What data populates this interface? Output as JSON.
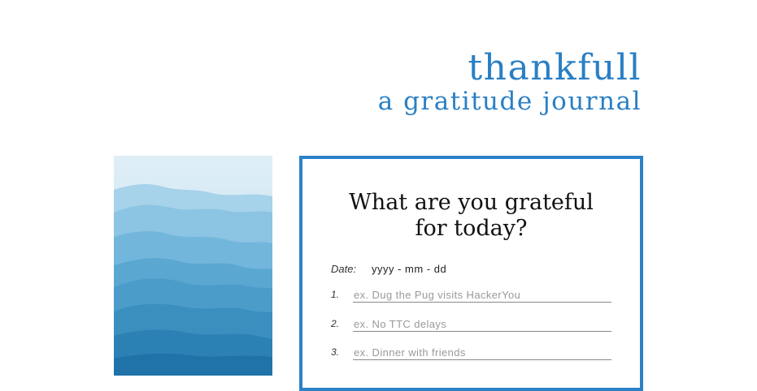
{
  "header": {
    "title": "thankfull",
    "subtitle": "a gratitude journal"
  },
  "colors": {
    "accent": "#2a82c9",
    "title_color": "#2a7fc4"
  },
  "image": {
    "icon": "blue-mountains-image"
  },
  "form": {
    "heading": "What are you grateful for today?",
    "date_label": "Date:",
    "date_placeholder": "yyyy - mm - dd",
    "entries": [
      {
        "number": "1.",
        "placeholder": "ex. Dug the Pug visits HackerYou"
      },
      {
        "number": "2.",
        "placeholder": "ex. No TTC delays"
      },
      {
        "number": "3.",
        "placeholder": "ex. Dinner with friends"
      }
    ]
  }
}
